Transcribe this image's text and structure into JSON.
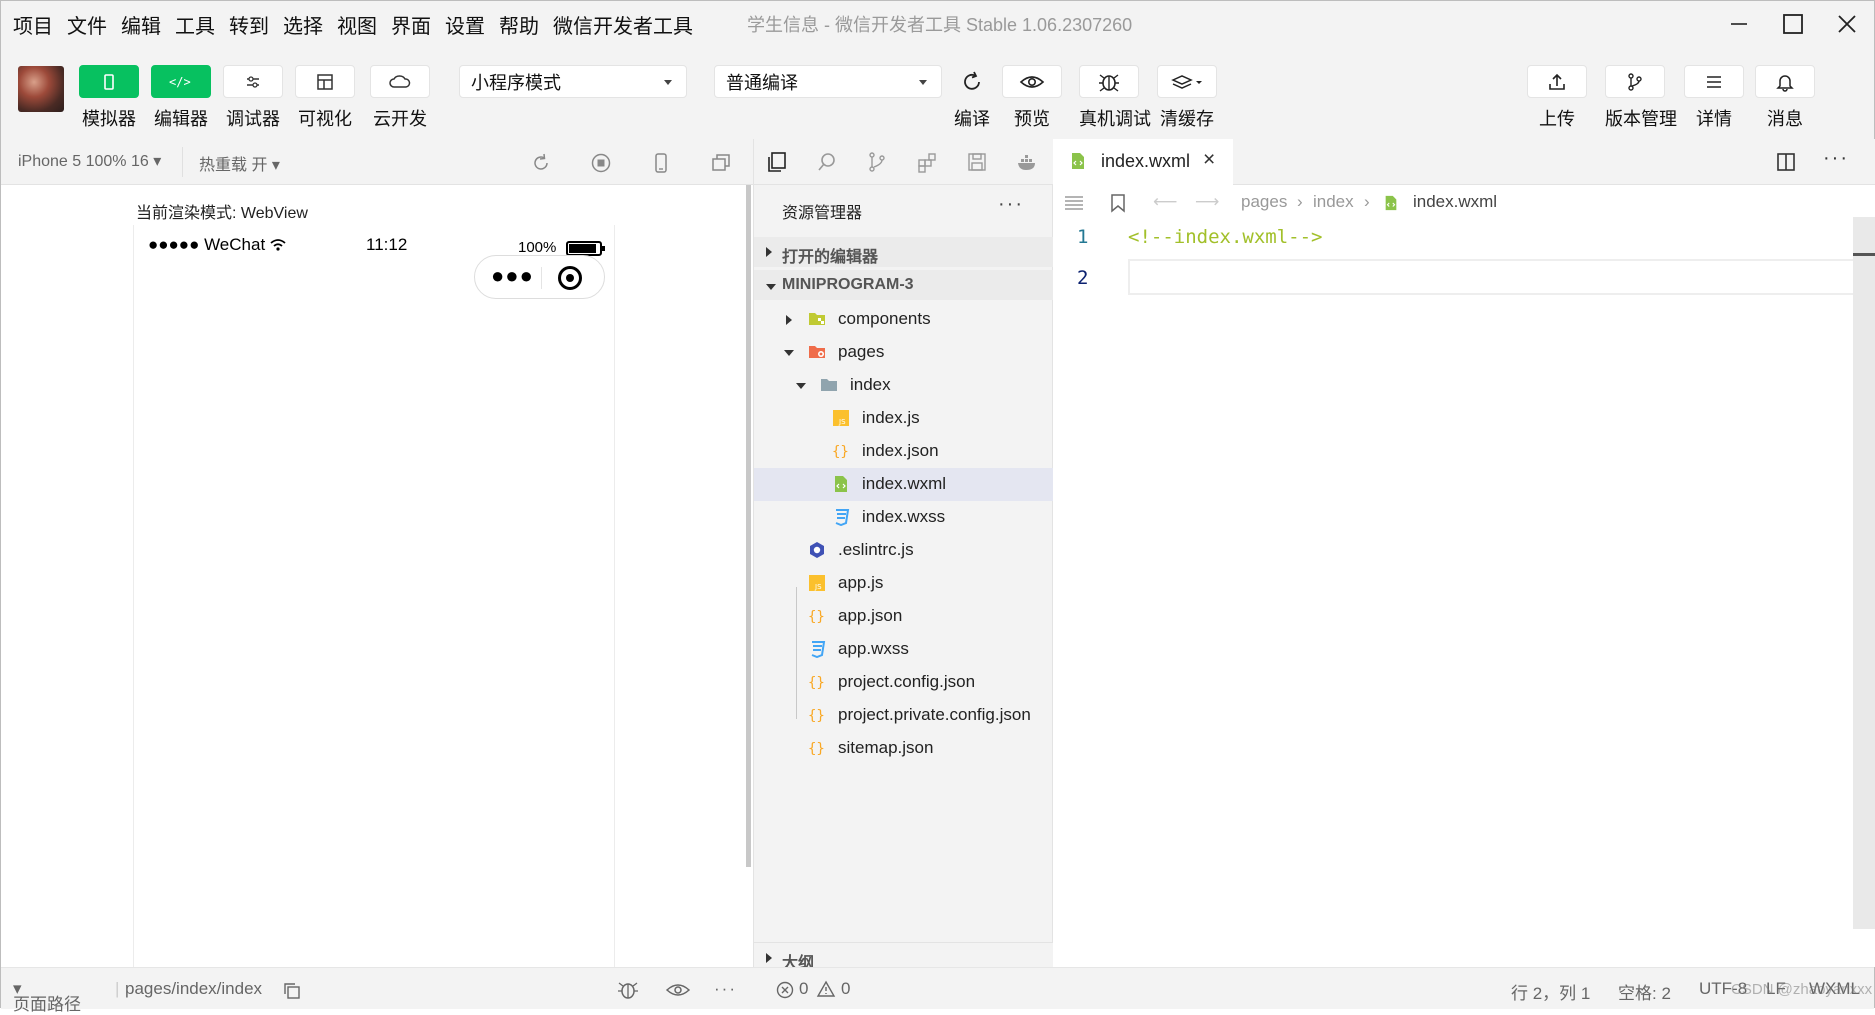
{
  "menu": [
    "项目",
    "文件",
    "编辑",
    "工具",
    "转到",
    "选择",
    "视图",
    "界面",
    "设置",
    "帮助",
    "微信开发者工具"
  ],
  "window_title": "学生信息 - 微信开发者工具 Stable 1.06.2307260",
  "toolbar": {
    "simulator": "模拟器",
    "editor": "编辑器",
    "debugger": "调试器",
    "visual": "可视化",
    "cloud": "云开发",
    "mode_select": "小程序模式",
    "compile_select": "普通编译",
    "compile": "编译",
    "preview": "预览",
    "real_debug": "真机调试",
    "clear_cache": "清缓存",
    "upload": "上传",
    "version": "版本管理",
    "details": "详情",
    "messages": "消息"
  },
  "simulator": {
    "device": "iPhone 5 100% 16",
    "hot_reload": "热重载 开",
    "render_mode": "当前渲染模式: WebView",
    "status_signal": "●●●●● WeChat",
    "status_time": "11:12",
    "status_battery": "100%"
  },
  "explorer": {
    "title": "资源管理器",
    "open_editors": "打开的编辑器",
    "project": "MINIPROGRAM-3",
    "outline": "大纲",
    "files": {
      "components": "components",
      "pages": "pages",
      "index": "index",
      "index_js": "index.js",
      "index_json": "index.json",
      "index_wxml": "index.wxml",
      "index_wxss": "index.wxss",
      "eslintrc": ".eslintrc.js",
      "app_js": "app.js",
      "app_json": "app.json",
      "app_wxss": "app.wxss",
      "project_config": "project.config.json",
      "project_private": "project.private.config.json",
      "sitemap": "sitemap.json"
    }
  },
  "editor": {
    "tab": "index.wxml",
    "breadcrumb": [
      "pages",
      "index",
      "index.wxml"
    ],
    "lines": [
      "1",
      "2"
    ],
    "code_line1": "<!--index.wxml-->"
  },
  "statusbar": {
    "page_path_label": "页面路径",
    "page_path": "pages/index/index",
    "errors": "0",
    "warnings": "0",
    "cursor": "行 2，列 1",
    "spaces": "空格: 2",
    "encoding": "UTF-8",
    "eol": "LF",
    "lang": "WXML",
    "watermark": "CSDN @zhaoyanxxx"
  },
  "colors": {
    "accent": "#07c160",
    "selection": "#e4e6f1",
    "line_number": "#237893",
    "code_comment": "#a2c02a"
  }
}
